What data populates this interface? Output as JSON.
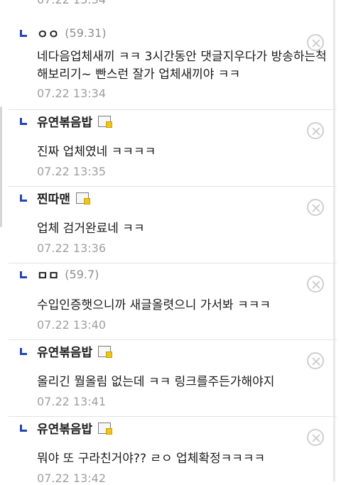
{
  "top_partial_date": "07.22 13:34",
  "comments": [
    {
      "name": "ㅇㅇ",
      "ip": "(59.31)",
      "badge": false,
      "text": "네다음업체새끼 ㅋㅋ 3시간동안 댓글지우다가 방송하는척해보리기~ 빤스런 잘가 업체새끼야 ㅋㅋ",
      "date": "07.22 13:34"
    },
    {
      "name": "유연볶음밥",
      "ip": "",
      "badge": true,
      "text": "진짜 업체였네 ㅋㅋㅋㅋ",
      "date": "07.22 13:35"
    },
    {
      "name": "찐따맨",
      "ip": "",
      "badge": true,
      "text": "업체 검거완료네 ㅋㅋ",
      "date": "07.22 13:36"
    },
    {
      "name": "ㅁㅁ",
      "ip": "(59.7)",
      "badge": false,
      "text": "수입인증햇으니까 새글올렷으니 가서봐 ㅋㅋㅋ",
      "date": "07.22 13:40"
    },
    {
      "name": "유연볶음밥",
      "ip": "",
      "badge": true,
      "text": "올리긴 뭘올림 없는데 ㅋㅋ 링크를주든가해야지",
      "date": "07.22 13:41"
    },
    {
      "name": "유연볶음밥",
      "ip": "",
      "badge": true,
      "text": "뭐야 또 구라친거야?? ㄹㅇ 업체확정ㅋㅋㅋㅋ",
      "date": "07.22 13:42"
    }
  ]
}
